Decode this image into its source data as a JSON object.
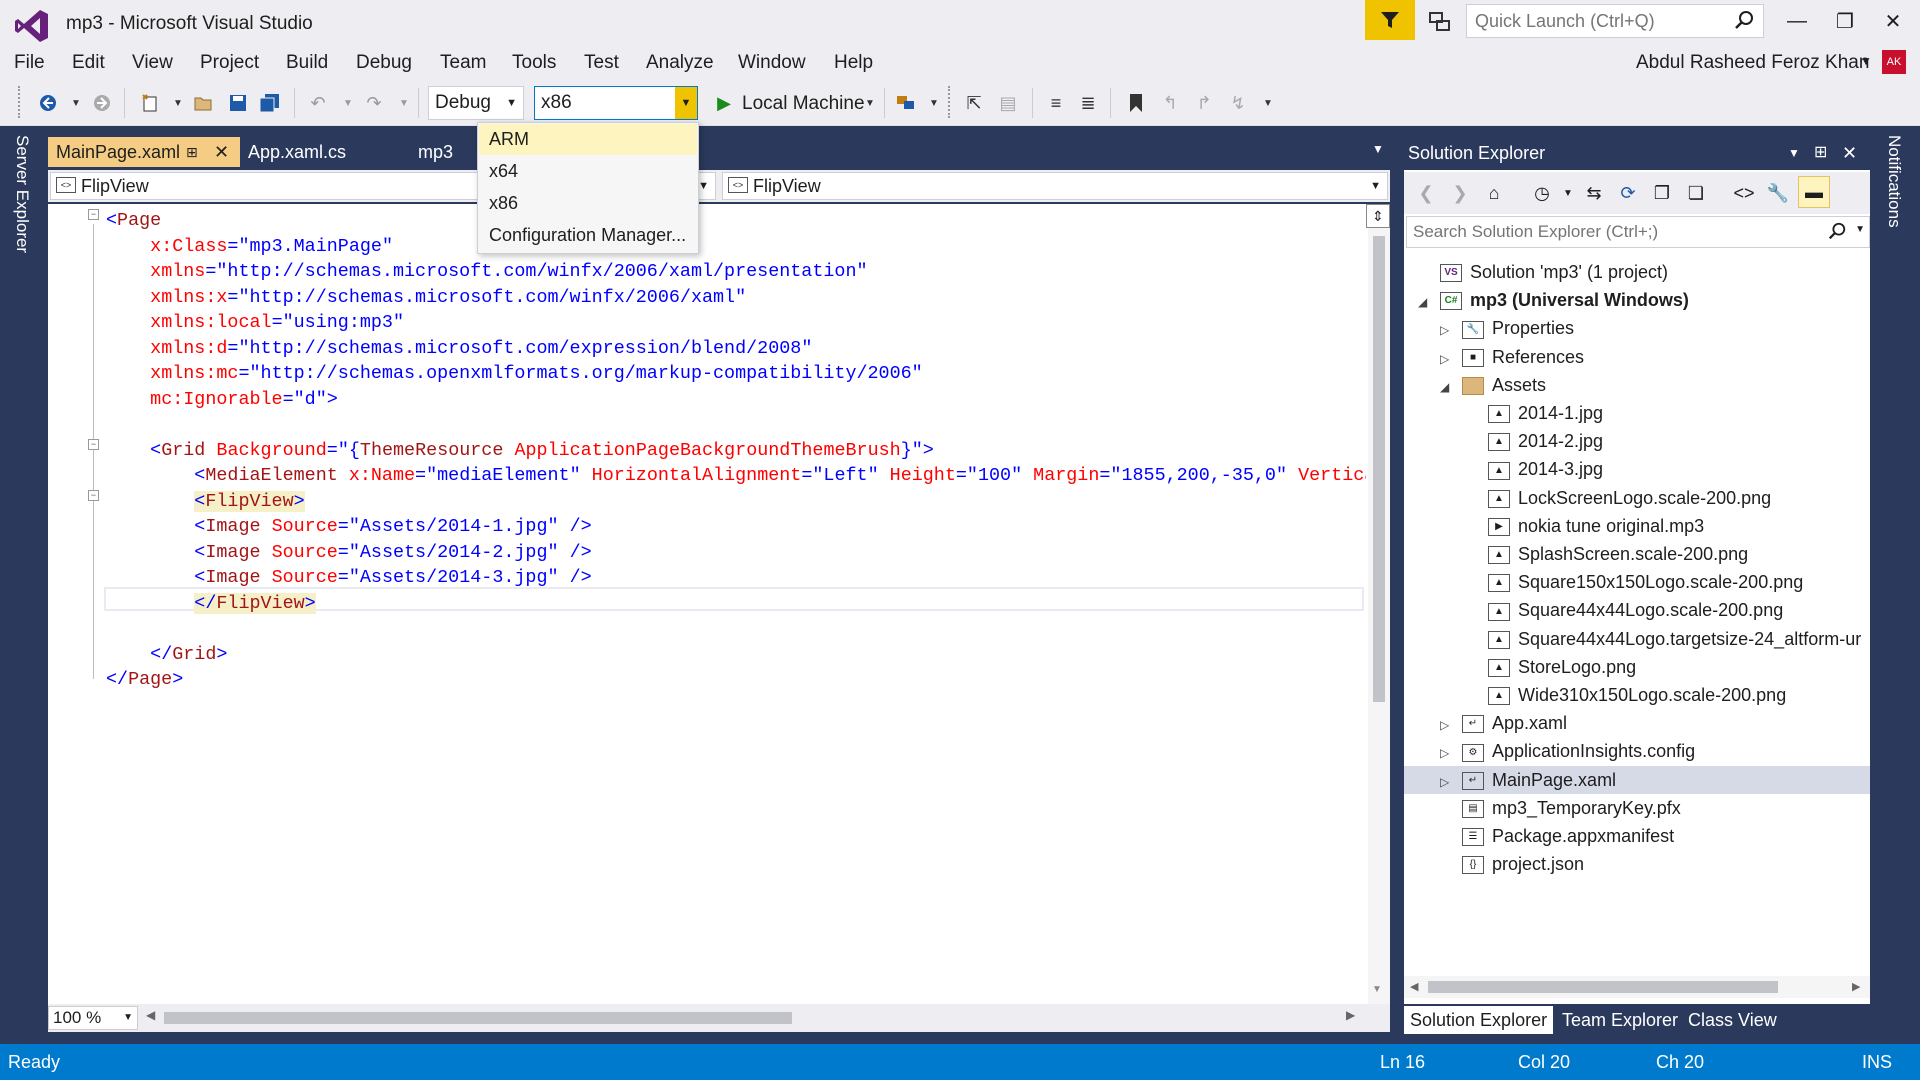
{
  "window": {
    "title": "mp3 - Microsoft Visual Studio"
  },
  "quick_launch": {
    "placeholder": "Quick Launch (Ctrl+Q)"
  },
  "menu": [
    "File",
    "Edit",
    "View",
    "Project",
    "Build",
    "Debug",
    "Team",
    "Tools",
    "Test",
    "Analyze",
    "Window",
    "Help"
  ],
  "user": {
    "name": "Abdul Rasheed Feroz Khan",
    "initials": "AK"
  },
  "toolbar": {
    "configuration": "Debug",
    "platform": "x86",
    "run_target": "Local Machine"
  },
  "platform_menu": {
    "items": [
      "ARM",
      "x64",
      "x86",
      "Configuration Manager..."
    ],
    "highlighted": "ARM"
  },
  "side_tabs": {
    "left": "Server Explorer",
    "right": "Notifications"
  },
  "editor_tabs": [
    {
      "label": "MainPage.xaml",
      "active": true
    },
    {
      "label": "App.xaml.cs",
      "active": false
    },
    {
      "label": "mp3",
      "active": false
    }
  ],
  "nav_bar": {
    "left": "FlipView",
    "right": "FlipView"
  },
  "code_lines": [
    [
      [
        "br",
        "<"
      ],
      [
        "el",
        "Page"
      ]
    ],
    [
      [
        "pad",
        "    "
      ],
      [
        "at",
        "x:Class"
      ],
      [
        "br",
        "="
      ],
      [
        "val",
        "\"mp3.MainPage\""
      ]
    ],
    [
      [
        "pad",
        "    "
      ],
      [
        "at",
        "xmlns"
      ],
      [
        "br",
        "="
      ],
      [
        "val",
        "\"http://schemas.microsoft.com/winfx/2006/xaml/presentation\""
      ]
    ],
    [
      [
        "pad",
        "    "
      ],
      [
        "at",
        "xmlns:x"
      ],
      [
        "br",
        "="
      ],
      [
        "val",
        "\"http://schemas.microsoft.com/winfx/2006/xaml\""
      ]
    ],
    [
      [
        "pad",
        "    "
      ],
      [
        "at",
        "xmlns:local"
      ],
      [
        "br",
        "="
      ],
      [
        "val",
        "\"using:mp3\""
      ]
    ],
    [
      [
        "pad",
        "    "
      ],
      [
        "at",
        "xmlns:d"
      ],
      [
        "br",
        "="
      ],
      [
        "val",
        "\"http://schemas.microsoft.com/expression/blend/2008\""
      ]
    ],
    [
      [
        "pad",
        "    "
      ],
      [
        "at",
        "xmlns:mc"
      ],
      [
        "br",
        "="
      ],
      [
        "val",
        "\"http://schemas.openxmlformats.org/markup-compatibility/2006\""
      ]
    ],
    [
      [
        "pad",
        "    "
      ],
      [
        "at",
        "mc:Ignorable"
      ],
      [
        "br",
        "="
      ],
      [
        "val",
        "\"d\""
      ],
      [
        "br",
        ">"
      ]
    ],
    [],
    [
      [
        "pad",
        "    "
      ],
      [
        "br",
        "<"
      ],
      [
        "el",
        "Grid"
      ],
      [
        "pad",
        " "
      ],
      [
        "at",
        "Background"
      ],
      [
        "br",
        "="
      ],
      [
        "val",
        "\"{"
      ],
      [
        "el",
        "ThemeResource"
      ],
      [
        "pad",
        " "
      ],
      [
        "at",
        "ApplicationPageBackgroundThemeBrush"
      ],
      [
        "val",
        "}\""
      ],
      [
        "br",
        ">"
      ]
    ],
    [
      [
        "pad",
        "        "
      ],
      [
        "br",
        "<"
      ],
      [
        "el",
        "MediaElement"
      ],
      [
        "pad",
        " "
      ],
      [
        "at",
        "x:Name"
      ],
      [
        "br",
        "="
      ],
      [
        "val",
        "\"mediaElement\""
      ],
      [
        "pad",
        " "
      ],
      [
        "at",
        "HorizontalAlignment"
      ],
      [
        "br",
        "="
      ],
      [
        "val",
        "\"Left\""
      ],
      [
        "pad",
        " "
      ],
      [
        "at",
        "Height"
      ],
      [
        "br",
        "="
      ],
      [
        "val",
        "\"100\""
      ],
      [
        "pad",
        " "
      ],
      [
        "at",
        "Margin"
      ],
      [
        "br",
        "="
      ],
      [
        "val",
        "\"1855,200,-35,0\""
      ],
      [
        "pad",
        " "
      ],
      [
        "at",
        "Vertica"
      ]
    ],
    [
      [
        "pad",
        "        "
      ],
      [
        "hlbr",
        "<"
      ],
      [
        "hlel",
        "FlipView"
      ],
      [
        "hlbr",
        ">"
      ]
    ],
    [
      [
        "pad",
        "        "
      ],
      [
        "br",
        "<"
      ],
      [
        "el",
        "Image"
      ],
      [
        "pad",
        " "
      ],
      [
        "at",
        "Source"
      ],
      [
        "br",
        "="
      ],
      [
        "val",
        "\"Assets/2014-1.jpg\""
      ],
      [
        "pad",
        " "
      ],
      [
        "br",
        "/>"
      ]
    ],
    [
      [
        "pad",
        "        "
      ],
      [
        "br",
        "<"
      ],
      [
        "el",
        "Image"
      ],
      [
        "pad",
        " "
      ],
      [
        "at",
        "Source"
      ],
      [
        "br",
        "="
      ],
      [
        "val",
        "\"Assets/2014-2.jpg\""
      ],
      [
        "pad",
        " "
      ],
      [
        "br",
        "/>"
      ]
    ],
    [
      [
        "pad",
        "        "
      ],
      [
        "br",
        "<"
      ],
      [
        "el",
        "Image"
      ],
      [
        "pad",
        " "
      ],
      [
        "at",
        "Source"
      ],
      [
        "br",
        "="
      ],
      [
        "val",
        "\"Assets/2014-3.jpg\""
      ],
      [
        "pad",
        " "
      ],
      [
        "br",
        "/>"
      ]
    ],
    [
      [
        "pad",
        "        "
      ],
      [
        "hlbr",
        "</"
      ],
      [
        "hlel",
        "FlipView"
      ],
      [
        "hlbr",
        ">"
      ]
    ],
    [],
    [
      [
        "pad",
        "    "
      ],
      [
        "br",
        "</"
      ],
      [
        "el",
        "Grid"
      ],
      [
        "br",
        ">"
      ]
    ],
    [
      [
        "br",
        "</"
      ],
      [
        "el",
        "Page"
      ],
      [
        "br",
        ">"
      ]
    ]
  ],
  "zoom": "100 %",
  "solution_explorer": {
    "title": "Solution Explorer",
    "search_placeholder": "Search Solution Explorer (Ctrl+;)",
    "tree": [
      {
        "label": "Solution 'mp3' (1 project)",
        "level": 0,
        "expander": "",
        "icon": "solution-icon",
        "bold": false
      },
      {
        "label": "mp3 (Universal Windows)",
        "level": 0,
        "expander": "◢",
        "icon": "csharp-project-icon",
        "bold": true
      },
      {
        "label": "Properties",
        "level": 1,
        "expander": "▷",
        "icon": "wrench-icon",
        "bold": false
      },
      {
        "label": "References",
        "level": 1,
        "expander": "▷",
        "icon": "references-icon",
        "bold": false
      },
      {
        "label": "Assets",
        "level": 1,
        "expander": "◢",
        "icon": "folder-icon",
        "bold": false
      },
      {
        "label": "2014-1.jpg",
        "level": 2,
        "expander": "",
        "icon": "image-file-icon",
        "bold": false
      },
      {
        "label": "2014-2.jpg",
        "level": 2,
        "expander": "",
        "icon": "image-file-icon",
        "bold": false
      },
      {
        "label": "2014-3.jpg",
        "level": 2,
        "expander": "",
        "icon": "image-file-icon",
        "bold": false
      },
      {
        "label": "LockScreenLogo.scale-200.png",
        "level": 2,
        "expander": "",
        "icon": "image-file-icon",
        "bold": false
      },
      {
        "label": "nokia tune original.mp3",
        "level": 2,
        "expander": "",
        "icon": "media-file-icon",
        "bold": false
      },
      {
        "label": "SplashScreen.scale-200.png",
        "level": 2,
        "expander": "",
        "icon": "image-file-icon",
        "bold": false
      },
      {
        "label": "Square150x150Logo.scale-200.png",
        "level": 2,
        "expander": "",
        "icon": "image-file-icon",
        "bold": false
      },
      {
        "label": "Square44x44Logo.scale-200.png",
        "level": 2,
        "expander": "",
        "icon": "image-file-icon",
        "bold": false
      },
      {
        "label": "Square44x44Logo.targetsize-24_altform-ur",
        "level": 2,
        "expander": "",
        "icon": "image-file-icon",
        "bold": false
      },
      {
        "label": "StoreLogo.png",
        "level": 2,
        "expander": "",
        "icon": "image-file-icon",
        "bold": false
      },
      {
        "label": "Wide310x150Logo.scale-200.png",
        "level": 2,
        "expander": "",
        "icon": "image-file-icon",
        "bold": false
      },
      {
        "label": "App.xaml",
        "level": 1,
        "expander": "▷",
        "icon": "xaml-file-icon",
        "bold": false
      },
      {
        "label": "ApplicationInsights.config",
        "level": 1,
        "expander": "▷",
        "icon": "config-file-icon",
        "bold": false
      },
      {
        "label": "MainPage.xaml",
        "level": 1,
        "expander": "▷",
        "icon": "xaml-file-icon",
        "bold": false,
        "selected": true
      },
      {
        "label": "mp3_TemporaryKey.pfx",
        "level": 1,
        "expander": "",
        "icon": "certificate-file-icon",
        "bold": false
      },
      {
        "label": "Package.appxmanifest",
        "level": 1,
        "expander": "",
        "icon": "manifest-file-icon",
        "bold": false
      },
      {
        "label": "project.json",
        "level": 1,
        "expander": "",
        "icon": "json-file-icon",
        "bold": false
      }
    ],
    "bottom_tabs": [
      "Solution Explorer",
      "Team Explorer",
      "Class View"
    ]
  },
  "status": {
    "state": "Ready",
    "line": "Ln 16",
    "col": "Col 20",
    "ch": "Ch 20",
    "mode": "INS"
  },
  "colors": {
    "status_bar": "#007acc",
    "frame": "#2b3a5c",
    "active_tab": "#f5cc84",
    "highlight": "#f0c300",
    "vs_purple": "#68217a"
  }
}
